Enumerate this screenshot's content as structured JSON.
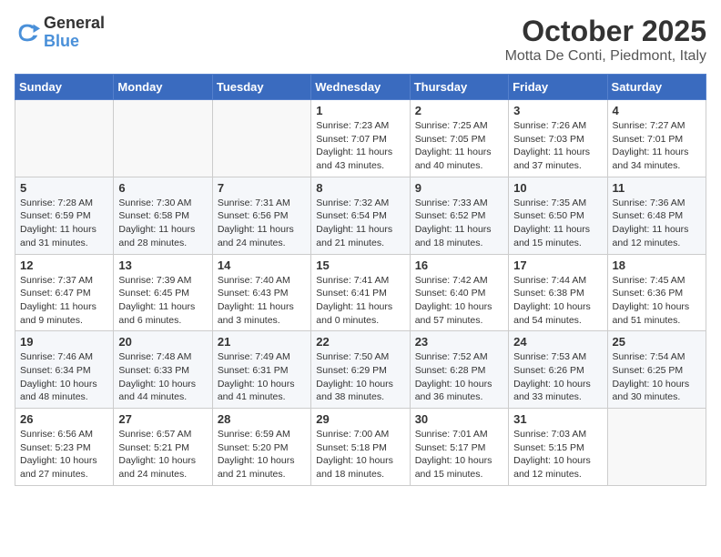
{
  "logo": {
    "general": "General",
    "blue": "Blue"
  },
  "title": "October 2025",
  "location": "Motta De Conti, Piedmont, Italy",
  "weekdays": [
    "Sunday",
    "Monday",
    "Tuesday",
    "Wednesday",
    "Thursday",
    "Friday",
    "Saturday"
  ],
  "weeks": [
    [
      {
        "day": "",
        "info": ""
      },
      {
        "day": "",
        "info": ""
      },
      {
        "day": "",
        "info": ""
      },
      {
        "day": "1",
        "info": "Sunrise: 7:23 AM\nSunset: 7:07 PM\nDaylight: 11 hours and 43 minutes."
      },
      {
        "day": "2",
        "info": "Sunrise: 7:25 AM\nSunset: 7:05 PM\nDaylight: 11 hours and 40 minutes."
      },
      {
        "day": "3",
        "info": "Sunrise: 7:26 AM\nSunset: 7:03 PM\nDaylight: 11 hours and 37 minutes."
      },
      {
        "day": "4",
        "info": "Sunrise: 7:27 AM\nSunset: 7:01 PM\nDaylight: 11 hours and 34 minutes."
      }
    ],
    [
      {
        "day": "5",
        "info": "Sunrise: 7:28 AM\nSunset: 6:59 PM\nDaylight: 11 hours and 31 minutes."
      },
      {
        "day": "6",
        "info": "Sunrise: 7:30 AM\nSunset: 6:58 PM\nDaylight: 11 hours and 28 minutes."
      },
      {
        "day": "7",
        "info": "Sunrise: 7:31 AM\nSunset: 6:56 PM\nDaylight: 11 hours and 24 minutes."
      },
      {
        "day": "8",
        "info": "Sunrise: 7:32 AM\nSunset: 6:54 PM\nDaylight: 11 hours and 21 minutes."
      },
      {
        "day": "9",
        "info": "Sunrise: 7:33 AM\nSunset: 6:52 PM\nDaylight: 11 hours and 18 minutes."
      },
      {
        "day": "10",
        "info": "Sunrise: 7:35 AM\nSunset: 6:50 PM\nDaylight: 11 hours and 15 minutes."
      },
      {
        "day": "11",
        "info": "Sunrise: 7:36 AM\nSunset: 6:48 PM\nDaylight: 11 hours and 12 minutes."
      }
    ],
    [
      {
        "day": "12",
        "info": "Sunrise: 7:37 AM\nSunset: 6:47 PM\nDaylight: 11 hours and 9 minutes."
      },
      {
        "day": "13",
        "info": "Sunrise: 7:39 AM\nSunset: 6:45 PM\nDaylight: 11 hours and 6 minutes."
      },
      {
        "day": "14",
        "info": "Sunrise: 7:40 AM\nSunset: 6:43 PM\nDaylight: 11 hours and 3 minutes."
      },
      {
        "day": "15",
        "info": "Sunrise: 7:41 AM\nSunset: 6:41 PM\nDaylight: 11 hours and 0 minutes."
      },
      {
        "day": "16",
        "info": "Sunrise: 7:42 AM\nSunset: 6:40 PM\nDaylight: 10 hours and 57 minutes."
      },
      {
        "day": "17",
        "info": "Sunrise: 7:44 AM\nSunset: 6:38 PM\nDaylight: 10 hours and 54 minutes."
      },
      {
        "day": "18",
        "info": "Sunrise: 7:45 AM\nSunset: 6:36 PM\nDaylight: 10 hours and 51 minutes."
      }
    ],
    [
      {
        "day": "19",
        "info": "Sunrise: 7:46 AM\nSunset: 6:34 PM\nDaylight: 10 hours and 48 minutes."
      },
      {
        "day": "20",
        "info": "Sunrise: 7:48 AM\nSunset: 6:33 PM\nDaylight: 10 hours and 44 minutes."
      },
      {
        "day": "21",
        "info": "Sunrise: 7:49 AM\nSunset: 6:31 PM\nDaylight: 10 hours and 41 minutes."
      },
      {
        "day": "22",
        "info": "Sunrise: 7:50 AM\nSunset: 6:29 PM\nDaylight: 10 hours and 38 minutes."
      },
      {
        "day": "23",
        "info": "Sunrise: 7:52 AM\nSunset: 6:28 PM\nDaylight: 10 hours and 36 minutes."
      },
      {
        "day": "24",
        "info": "Sunrise: 7:53 AM\nSunset: 6:26 PM\nDaylight: 10 hours and 33 minutes."
      },
      {
        "day": "25",
        "info": "Sunrise: 7:54 AM\nSunset: 6:25 PM\nDaylight: 10 hours and 30 minutes."
      }
    ],
    [
      {
        "day": "26",
        "info": "Sunrise: 6:56 AM\nSunset: 5:23 PM\nDaylight: 10 hours and 27 minutes."
      },
      {
        "day": "27",
        "info": "Sunrise: 6:57 AM\nSunset: 5:21 PM\nDaylight: 10 hours and 24 minutes."
      },
      {
        "day": "28",
        "info": "Sunrise: 6:59 AM\nSunset: 5:20 PM\nDaylight: 10 hours and 21 minutes."
      },
      {
        "day": "29",
        "info": "Sunrise: 7:00 AM\nSunset: 5:18 PM\nDaylight: 10 hours and 18 minutes."
      },
      {
        "day": "30",
        "info": "Sunrise: 7:01 AM\nSunset: 5:17 PM\nDaylight: 10 hours and 15 minutes."
      },
      {
        "day": "31",
        "info": "Sunrise: 7:03 AM\nSunset: 5:15 PM\nDaylight: 10 hours and 12 minutes."
      },
      {
        "day": "",
        "info": ""
      }
    ]
  ]
}
